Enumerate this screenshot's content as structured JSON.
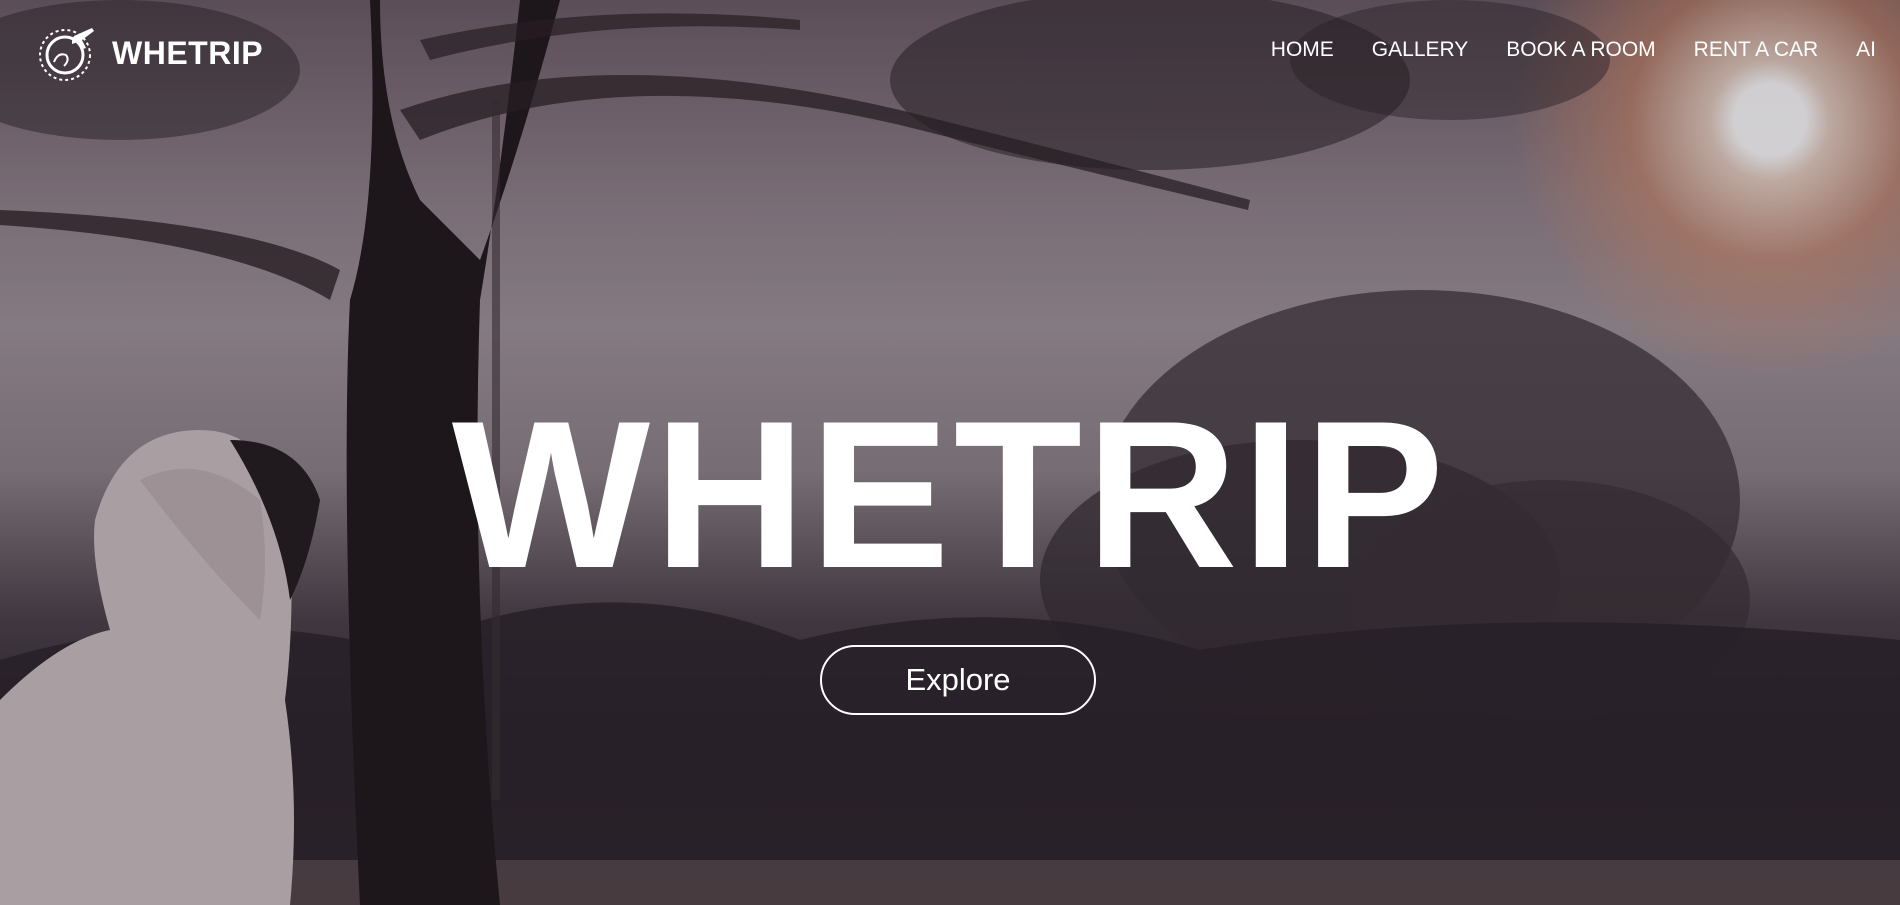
{
  "brand": {
    "name": "WHETRIP",
    "logo_icon": "globe-plane-icon"
  },
  "nav": {
    "items": [
      {
        "label": "HOME"
      },
      {
        "label": "GALLERY"
      },
      {
        "label": "BOOK A ROOM"
      },
      {
        "label": "RENT A CAR"
      },
      {
        "label": "AI"
      }
    ]
  },
  "hero": {
    "title": "WHETRIP",
    "explore_label": "Explore",
    "background_image": "hooded-person-tree-sunset-photo"
  },
  "colors": {
    "text": "#ffffff",
    "button_border": "#ffffff"
  }
}
